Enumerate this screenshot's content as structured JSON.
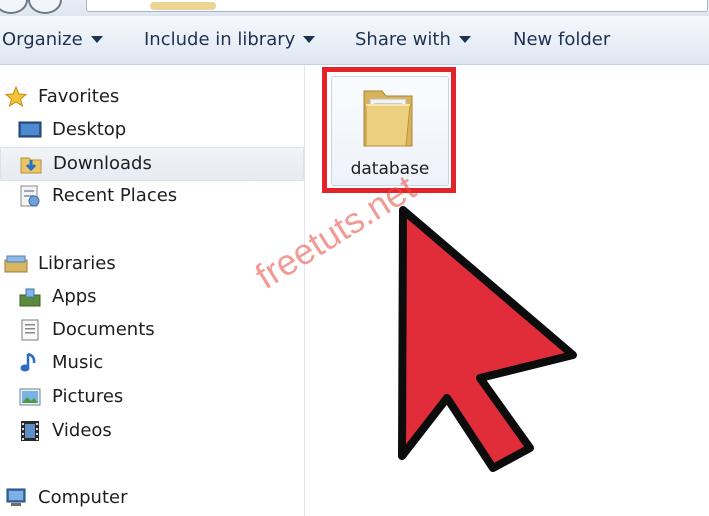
{
  "toolbar": {
    "organize": "Organize",
    "include_in_library": "Include in library",
    "share_with": "Share with",
    "new_folder": "New folder"
  },
  "nav": {
    "favorites": {
      "label": "Favorites",
      "items": [
        {
          "label": "Desktop",
          "icon": "desktop-icon"
        },
        {
          "label": "Downloads",
          "icon": "downloads-icon",
          "selected": true
        },
        {
          "label": "Recent Places",
          "icon": "recent-places-icon"
        }
      ]
    },
    "libraries": {
      "label": "Libraries",
      "items": [
        {
          "label": "Apps",
          "icon": "apps-icon"
        },
        {
          "label": "Documents",
          "icon": "documents-icon"
        },
        {
          "label": "Music",
          "icon": "music-icon"
        },
        {
          "label": "Pictures",
          "icon": "pictures-icon"
        },
        {
          "label": "Videos",
          "icon": "videos-icon"
        }
      ]
    },
    "computer": {
      "label": "Computer"
    }
  },
  "content": {
    "items": [
      {
        "name": "database",
        "type": "folder",
        "highlighted": true
      }
    ]
  },
  "watermark": "freetuts.net",
  "colors": {
    "highlight_box": "#e4222a",
    "arrow_fill": "#e12d3a",
    "toolbar_text": "#1e3251"
  }
}
